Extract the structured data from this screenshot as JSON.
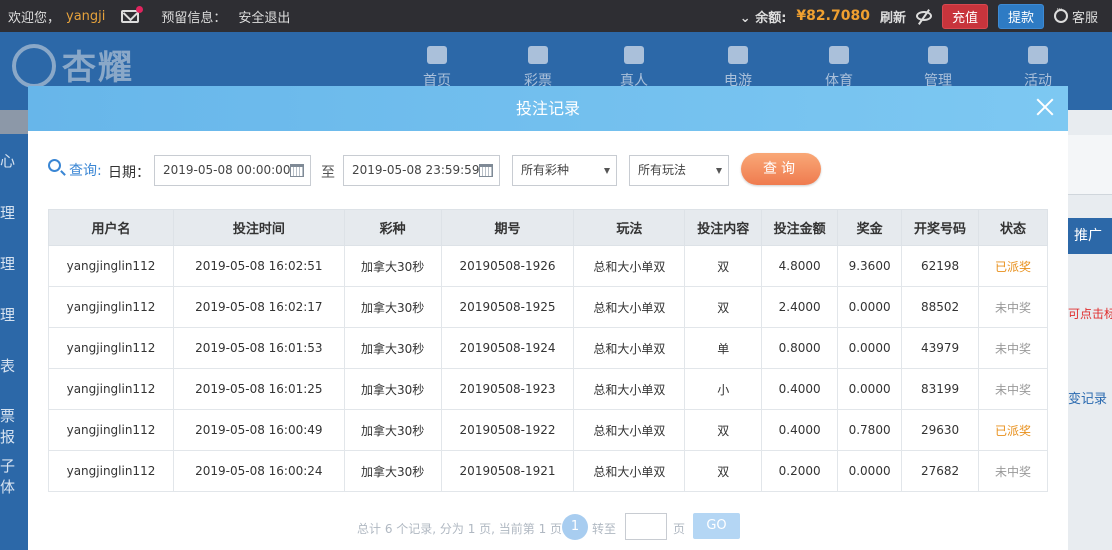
{
  "topbar": {
    "welcome": "欢迎您，",
    "username": "yangji",
    "reserve_label": "预留信息：",
    "logout": "安全退出",
    "balance_label": "余额:",
    "balance_value": "¥82.7080",
    "refresh": "刷新",
    "recharge": "充值",
    "withdraw": "提款",
    "service": "客服"
  },
  "nav": {
    "logo": "杏耀",
    "items": [
      "首页",
      "彩票",
      "真人",
      "电游",
      "体育",
      "管理",
      "活动"
    ]
  },
  "background": {
    "side_items": [
      "心",
      "理",
      "理",
      "理",
      "表",
      "票报",
      "子体"
    ],
    "right_tab": "推广",
    "right_red": "可点击标题",
    "right_link": "变记录"
  },
  "modal": {
    "title": "投注记录",
    "filters": {
      "query_label": "查询:",
      "date_label": "日期：",
      "start_date": "2019-05-08 00:00:00",
      "to_label": "至",
      "end_date": "2019-05-08 23:59:59",
      "lottery_select": "所有彩种",
      "play_select": "所有玩法",
      "query_button": "查询"
    },
    "table": {
      "headers": [
        "用户名",
        "投注时间",
        "彩种",
        "期号",
        "玩法",
        "投注内容",
        "投注金额",
        "奖金",
        "开奖号码",
        "状态"
      ],
      "rows": [
        [
          "yangjinglin112",
          "2019-05-08 16:02:51",
          "加拿大30秒",
          "20190508-1926",
          "总和大小单双",
          "双",
          "4.8000",
          "9.3600",
          "62198",
          "已派奖"
        ],
        [
          "yangjinglin112",
          "2019-05-08 16:02:17",
          "加拿大30秒",
          "20190508-1925",
          "总和大小单双",
          "双",
          "2.4000",
          "0.0000",
          "88502",
          "未中奖"
        ],
        [
          "yangjinglin112",
          "2019-05-08 16:01:53",
          "加拿大30秒",
          "20190508-1924",
          "总和大小单双",
          "单",
          "0.8000",
          "0.0000",
          "43979",
          "未中奖"
        ],
        [
          "yangjinglin112",
          "2019-05-08 16:01:25",
          "加拿大30秒",
          "20190508-1923",
          "总和大小单双",
          "小",
          "0.4000",
          "0.0000",
          "83199",
          "未中奖"
        ],
        [
          "yangjinglin112",
          "2019-05-08 16:00:49",
          "加拿大30秒",
          "20190508-1922",
          "总和大小单双",
          "双",
          "0.4000",
          "0.7800",
          "29630",
          "已派奖"
        ],
        [
          "yangjinglin112",
          "2019-05-08 16:00:24",
          "加拿大30秒",
          "20190508-1921",
          "总和大小单双",
          "双",
          "0.2000",
          "0.0000",
          "27682",
          "未中奖"
        ]
      ]
    },
    "pager": {
      "summary": "总计 6 个记录, 分为 1 页, 当前第 1 页",
      "current_page": "1",
      "goto_label": "转至",
      "page_unit": "页",
      "go_button": "GO"
    }
  },
  "colors": {
    "won": "#e8901c",
    "lost": "#999999",
    "header_gradient_start": "#67b6ea",
    "nav_bg": "#2c68a8"
  }
}
